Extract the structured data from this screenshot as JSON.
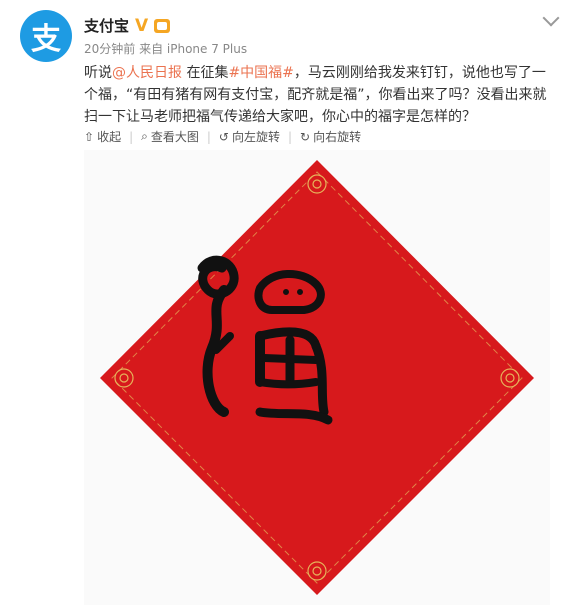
{
  "account": {
    "avatar_glyph": "支",
    "name": "支付宝",
    "verified_badge": "V",
    "meta": "20分钟前 来自 iPhone 7 Plus"
  },
  "post": {
    "segments": [
      {
        "text": "听说",
        "link": false
      },
      {
        "text": "@人民日报",
        "link": true
      },
      {
        "text": " 在征集",
        "link": false
      },
      {
        "text": "#中国福#",
        "link": true
      },
      {
        "text": "，马云刚刚给我发来钉钉，说他也写了一个福，“有田有猪有网有支付宝，配齐就是福”，你看出来了吗？没看出来就扫一下让马老师把福气传递给大家吧，你心中的福字是怎样的？",
        "link": false
      }
    ]
  },
  "toolbar": {
    "collapse": "收起",
    "view_large": "查看大图",
    "rotate_left": "向左旋转",
    "rotate_right": "向右旋转"
  },
  "colors": {
    "brand_blue": "#1e9be3",
    "link_orange": "#eb7350",
    "diamond_red": "#d7191c",
    "ornament_gold": "#e6b35a"
  }
}
